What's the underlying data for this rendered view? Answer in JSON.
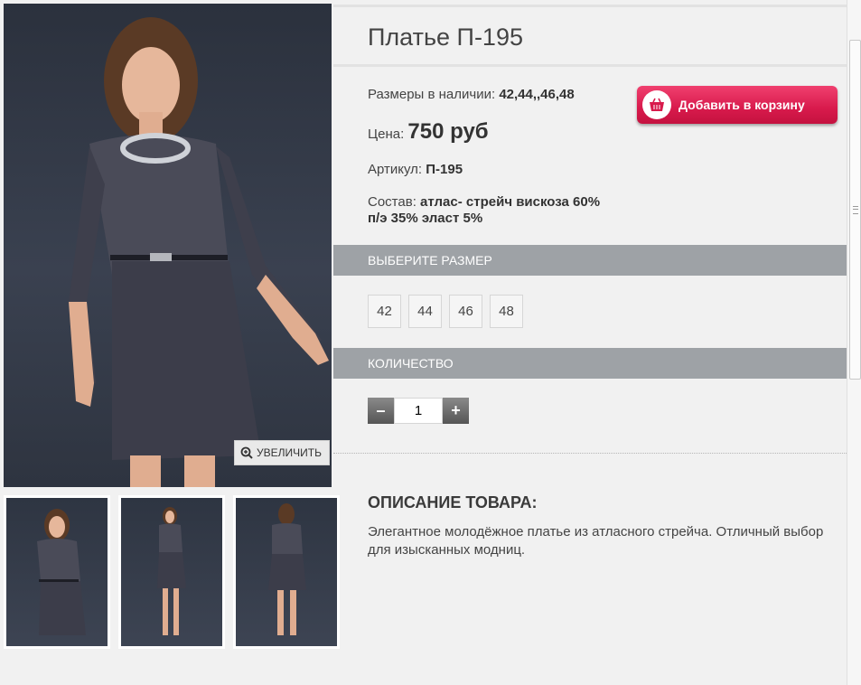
{
  "product": {
    "title": "Платье П-195",
    "sizes_label": "Размеры в наличии:",
    "sizes_value": "42,44,,46,48",
    "price_label": "Цена:",
    "price_value": "750 руб",
    "sku_label": "Артикул:",
    "sku_value": "П-195",
    "composition_label": "Состав:",
    "composition_value_line1": "атлас- стрейч вискоза 60%",
    "composition_value_line2": "п/э 35% эласт 5%"
  },
  "cart_button": {
    "label": "Добавить в корзину"
  },
  "gallery": {
    "zoom_label": "УВЕЛИЧИТЬ"
  },
  "size_section": {
    "title": "ВЫБЕРИТЕ РАЗМЕР",
    "options": [
      "42",
      "44",
      "46",
      "48"
    ]
  },
  "quantity_section": {
    "title": "КОЛИЧЕСТВО",
    "minus": "–",
    "plus": "+",
    "value": "1"
  },
  "description": {
    "title": "ОПИСАНИЕ ТОВАРА:",
    "text": "Элегантное молодёжное платье из атласного стрейча. Отличный выбор для изысканных модниц."
  },
  "colors": {
    "accent": "#d81a4c",
    "section_bar": "#9ea2a6"
  }
}
